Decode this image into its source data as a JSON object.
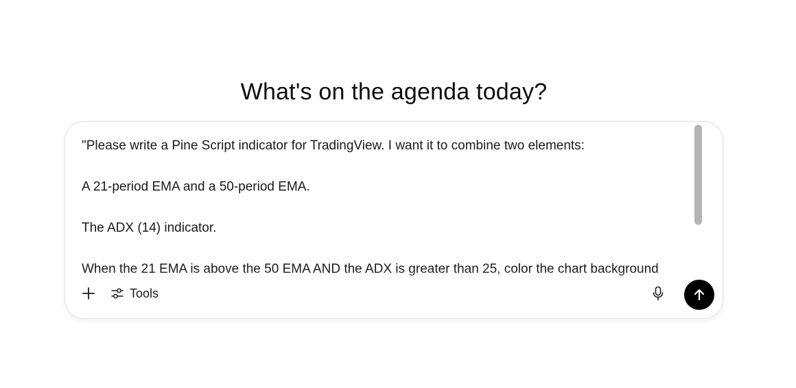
{
  "heading": "What's on the agenda today?",
  "composer": {
    "lines": [
      "\"Please write a Pine Script indicator for TradingView. I want it to combine two elements:",
      "A 21-period EMA and a 50-period EMA.",
      "The ADX (14) indicator.",
      "When the 21 EMA is above the 50 EMA AND the ADX is greater than 25, color the chart background"
    ],
    "tools_label": "Tools"
  },
  "icons": {
    "add": "plus-icon",
    "tools": "sliders-icon",
    "mic": "microphone-icon",
    "send": "arrow-up-icon"
  },
  "colors": {
    "send_button": "#000000",
    "scrollbar": "#b4b4b4",
    "border": "#e3e3e3"
  }
}
